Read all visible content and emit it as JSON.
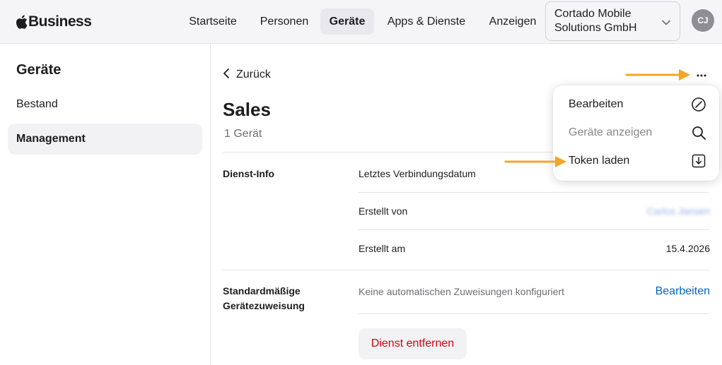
{
  "header": {
    "brand": "Business",
    "nav": [
      {
        "label": "Startseite",
        "active": false
      },
      {
        "label": "Personen",
        "active": false
      },
      {
        "label": "Geräte",
        "active": true
      },
      {
        "label": "Apps & Dienste",
        "active": false
      },
      {
        "label": "Anzeigen",
        "active": false
      }
    ],
    "organization": "Cortado Mobile Solutions GmbH",
    "avatar_initials": "CJ"
  },
  "sidebar": {
    "title": "Geräte",
    "items": [
      {
        "label": "Bestand",
        "active": false
      },
      {
        "label": "Management",
        "active": true
      }
    ]
  },
  "main": {
    "back_label": "Zurück",
    "title": "Sales",
    "subtitle": "1 Gerät",
    "service_info": {
      "label": "Dienst-Info",
      "rows": [
        {
          "label": "Letztes Verbindungsdatum",
          "value": ""
        },
        {
          "label": "Erstellt von",
          "value": "Carlos Jansen"
        },
        {
          "label": "Erstellt am",
          "value": "15.4.2026"
        }
      ]
    },
    "default_assignment": {
      "label": "Standardmäßige Gerätezuweisung",
      "description": "Keine automatischen Zuweisungen konfiguriert",
      "edit_label": "Bearbeiten"
    },
    "remove_button": "Dienst entfernen"
  },
  "menu": {
    "items": [
      {
        "label": "Bearbeiten",
        "icon": "edit-icon",
        "disabled": false
      },
      {
        "label": "Geräte anzeigen",
        "icon": "search-icon",
        "disabled": true
      },
      {
        "label": "Token laden",
        "icon": "download-icon",
        "disabled": false
      }
    ]
  },
  "colors": {
    "accent": "#0066cc",
    "danger": "#d70015",
    "annotation_arrow": "#f5a623"
  }
}
